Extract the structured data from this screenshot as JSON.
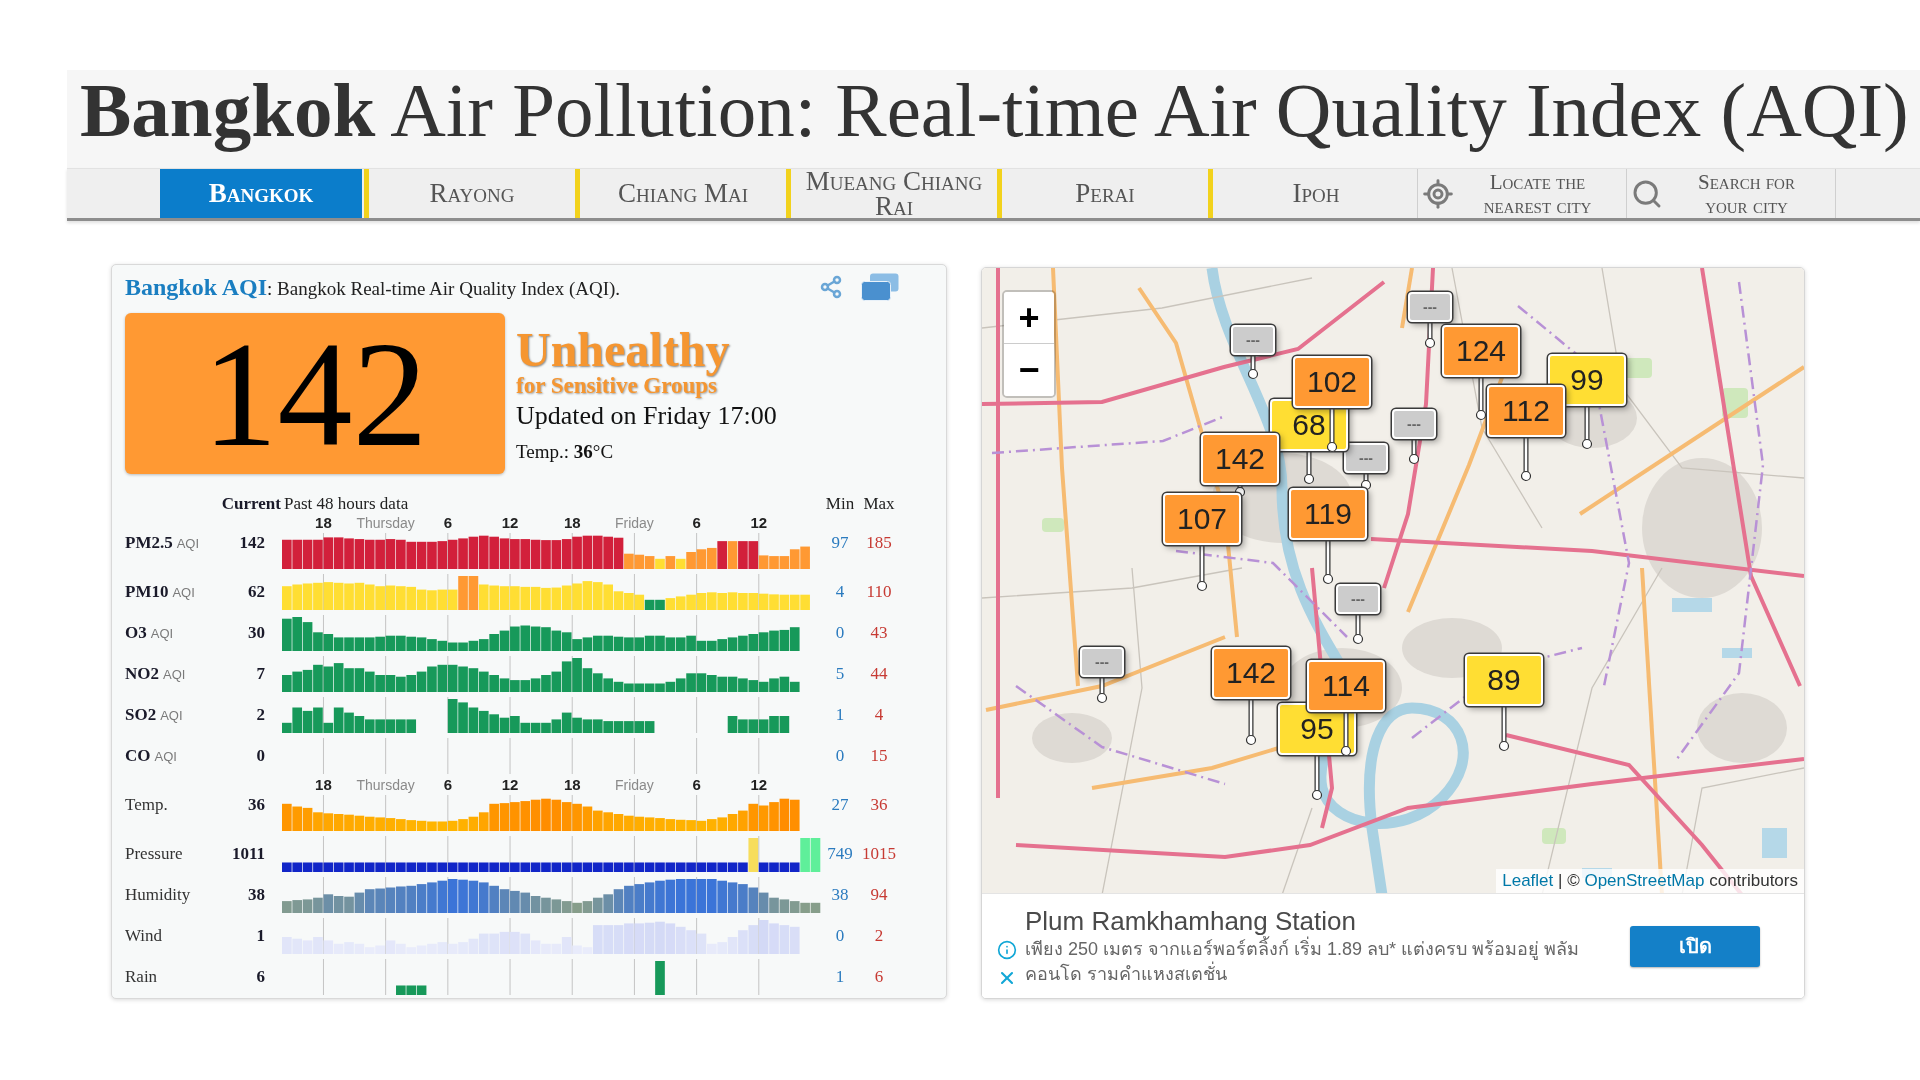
{
  "page_title": "**Bangkok** Air Pollution: Real-time Air Quality Index (AQI)",
  "nav": {
    "tabs": [
      {
        "label": "Bangkok",
        "selected": true
      },
      {
        "label": "Rayong",
        "selected": false
      },
      {
        "label": "Chiang Mai",
        "selected": false
      },
      {
        "label": "Mueang Chiang Rai",
        "selected": false
      },
      {
        "label": "Perai",
        "selected": false
      },
      {
        "label": "Ipoh",
        "selected": false
      }
    ],
    "tools": [
      {
        "kind": "locate",
        "label": "Locate the nearest city"
      },
      {
        "kind": "search",
        "label": "Search for your city"
      }
    ]
  },
  "aqi_panel": {
    "title": "Bangkok AQI",
    "subtitle": ": Bangkok Real-time Air Quality Index (AQI).",
    "aqi": "142",
    "kind": "unhealthy_for_sensitive",
    "status": "Unhealthy",
    "status_detail": "for Sensitive Groups",
    "updated": "Updated on Friday 17:00",
    "temperature": "Temp.: **36**°C",
    "columns": {
      "current": "Current",
      "history": "Past 48 hours data",
      "min": "Min",
      "max": "Max"
    },
    "sections": [
      {
        "axis": [
          {
            "label": "18",
            "kind": "hour"
          },
          {
            "label": "Thursday",
            "kind": "day"
          },
          {
            "label": "6",
            "kind": "hour"
          },
          {
            "label": "12",
            "kind": "hour"
          },
          {
            "label": "18",
            "kind": "hour"
          },
          {
            "label": "Friday",
            "kind": "day"
          },
          {
            "label": "6",
            "kind": "hour"
          },
          {
            "label": "12",
            "kind": "hour"
          }
        ],
        "rows": [
          {
            "name": "PM2.5",
            "unit": "AQI",
            "current": "142",
            "min": "97",
            "max": "185",
            "kind": "aqi"
          },
          {
            "name": "PM10",
            "unit": "AQI",
            "current": "62",
            "min": "4",
            "max": "110",
            "kind": "aqi"
          },
          {
            "name": "O3",
            "unit": "AQI",
            "current": "30",
            "min": "0",
            "max": "43",
            "kind": "aqi"
          },
          {
            "name": "NO2",
            "unit": "AQI",
            "current": "7",
            "min": "5",
            "max": "44",
            "kind": "aqi"
          },
          {
            "name": "SO2",
            "unit": "AQI",
            "current": "2",
            "min": "1",
            "max": "4",
            "kind": "aqi"
          },
          {
            "name": "CO",
            "unit": "AQI",
            "current": "0",
            "min": "0",
            "max": "15",
            "kind": "aqi"
          }
        ]
      },
      {
        "axis": [
          {
            "label": "18",
            "kind": "hour"
          },
          {
            "label": "Thursday",
            "kind": "day"
          },
          {
            "label": "6",
            "kind": "hour"
          },
          {
            "label": "12",
            "kind": "hour"
          },
          {
            "label": "18",
            "kind": "hour"
          },
          {
            "label": "Friday",
            "kind": "day"
          },
          {
            "label": "6",
            "kind": "hour"
          },
          {
            "label": "12",
            "kind": "hour"
          }
        ],
        "rows": [
          {
            "name": "Temp.",
            "current": "36",
            "min": "27",
            "max": "36",
            "kind": "temperature"
          },
          {
            "name": "Pressure",
            "current": "1011",
            "min": "749",
            "max": "1015",
            "kind": "pressure"
          },
          {
            "name": "Humidity",
            "current": "38",
            "min": "38",
            "max": "94",
            "kind": "humidity"
          },
          {
            "name": "Wind",
            "current": "1",
            "min": "0",
            "max": "2",
            "kind": "wind"
          },
          {
            "name": "Rain",
            "current": "6",
            "min": "1",
            "max": "6",
            "kind": "rain"
          }
        ]
      }
    ]
  },
  "map": {
    "zoom_in": "+",
    "zoom_out": "−",
    "markers": [
      {
        "value": "---",
        "kind": "no_data",
        "color": "#cccccc"
      },
      {
        "value": "---",
        "kind": "no_data",
        "color": "#cccccc"
      },
      {
        "value": "124",
        "kind": "reading",
        "color": "#ff9933"
      },
      {
        "value": "102",
        "kind": "reading",
        "color": "#ff9933"
      },
      {
        "value": "99",
        "kind": "reading",
        "color": "#ffde33"
      },
      {
        "value": "68",
        "kind": "reading",
        "color": "#ffde33"
      },
      {
        "value": "---",
        "kind": "no_data",
        "color": "#cccccc"
      },
      {
        "value": "112",
        "kind": "reading",
        "color": "#ff9933"
      },
      {
        "value": "142",
        "kind": "reading",
        "color": "#ff9933"
      },
      {
        "value": "---",
        "kind": "no_data",
        "color": "#cccccc"
      },
      {
        "value": "107",
        "kind": "reading",
        "color": "#ff9933"
      },
      {
        "value": "119",
        "kind": "reading",
        "color": "#ff9933"
      },
      {
        "value": "---",
        "kind": "no_data",
        "color": "#cccccc"
      },
      {
        "value": "---",
        "kind": "no_data",
        "color": "#cccccc"
      },
      {
        "value": "142",
        "kind": "reading",
        "color": "#ff9933"
      },
      {
        "value": "114",
        "kind": "reading",
        "color": "#ff9933"
      },
      {
        "value": "89",
        "kind": "reading",
        "color": "#ffde33"
      },
      {
        "value": "95",
        "kind": "reading",
        "color": "#ffde33"
      }
    ],
    "attribution": {
      "leaflet": "Leaflet",
      "separator": "|",
      "copyright": "©",
      "osm": "OpenStreetMap",
      "suffix": "contributors"
    }
  },
  "ad": {
    "title": "Plum Ramkhamhang Station",
    "text": "เพียง 250 เมตร จากแอร์พอร์ตลิ้งก์ เริ่ม 1.89 ลบ* แต่งครบ พร้อมอยู่ พลัม คอนโด รามคำแหงสเตชั่น",
    "button": "เปิด"
  }
}
